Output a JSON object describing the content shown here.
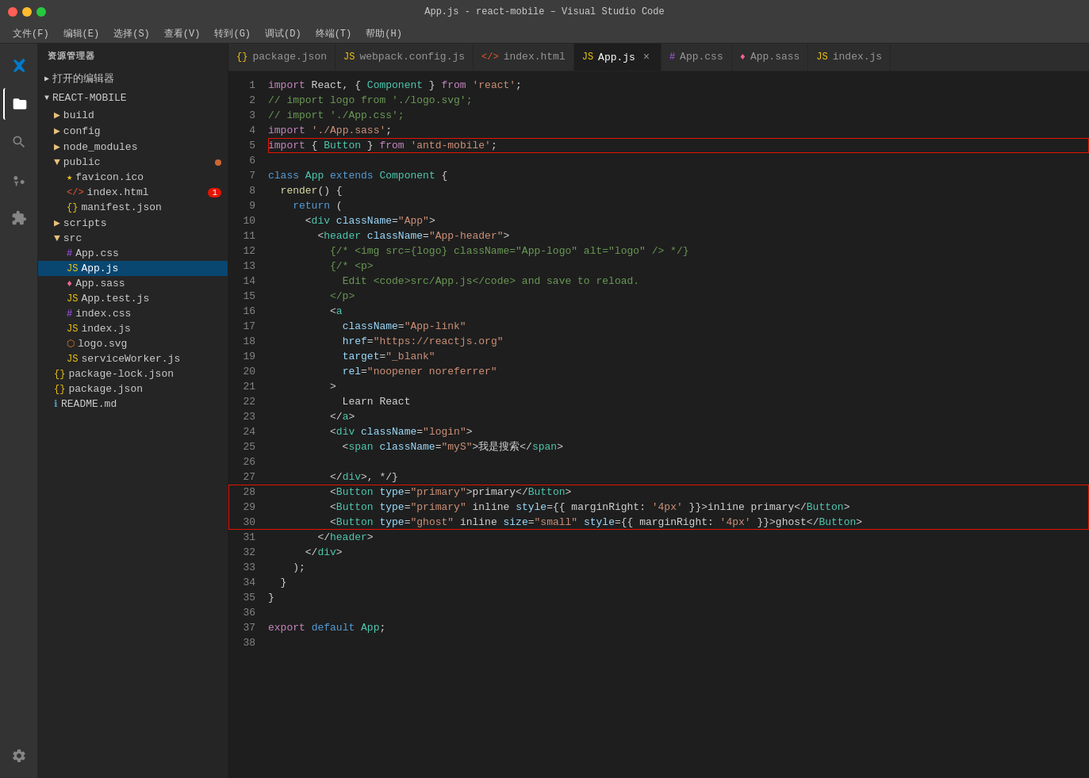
{
  "titleBar": {
    "title": "App.js - react-mobile – Visual Studio Code"
  },
  "menuBar": {
    "items": [
      "文件(F)",
      "编辑(E)",
      "选择(S)",
      "查看(V)",
      "转到(G)",
      "调试(D)",
      "终端(T)",
      "帮助(H)"
    ]
  },
  "sidebar": {
    "header": "资源管理器",
    "openEditors": "打开的编辑器",
    "rootFolder": "REACT-MOBILE",
    "tree": [
      {
        "name": "build",
        "type": "folder",
        "depth": 1
      },
      {
        "name": "config",
        "type": "folder",
        "depth": 1
      },
      {
        "name": "node_modules",
        "type": "folder",
        "depth": 1
      },
      {
        "name": "public",
        "type": "folder-open",
        "depth": 1,
        "hasDot": true
      },
      {
        "name": "favicon.ico",
        "type": "favicon",
        "depth": 2
      },
      {
        "name": "index.html",
        "type": "html",
        "depth": 2,
        "badge": "1"
      },
      {
        "name": "manifest.json",
        "type": "json",
        "depth": 2
      },
      {
        "name": "scripts",
        "type": "folder",
        "depth": 1
      },
      {
        "name": "src",
        "type": "folder-open",
        "depth": 1
      },
      {
        "name": "App.css",
        "type": "css",
        "depth": 2
      },
      {
        "name": "App.js",
        "type": "js",
        "depth": 2,
        "active": true
      },
      {
        "name": "App.sass",
        "type": "sass",
        "depth": 2
      },
      {
        "name": "App.test.js",
        "type": "js",
        "depth": 2
      },
      {
        "name": "index.css",
        "type": "css",
        "depth": 2
      },
      {
        "name": "index.js",
        "type": "js",
        "depth": 2
      },
      {
        "name": "logo.svg",
        "type": "svg",
        "depth": 2
      },
      {
        "name": "serviceWorker.js",
        "type": "js",
        "depth": 2
      },
      {
        "name": "package-lock.json",
        "type": "json",
        "depth": 0
      },
      {
        "name": "package.json",
        "type": "json",
        "depth": 0
      },
      {
        "name": "README.md",
        "type": "md",
        "depth": 0
      }
    ]
  },
  "tabs": [
    {
      "label": "package.json",
      "type": "json",
      "active": false
    },
    {
      "label": "webpack.config.js",
      "type": "js",
      "active": false
    },
    {
      "label": "index.html",
      "type": "html",
      "active": false
    },
    {
      "label": "App.js",
      "type": "js",
      "active": true,
      "closeable": true
    },
    {
      "label": "App.css",
      "type": "css",
      "active": false
    },
    {
      "label": "App.sass",
      "type": "sass",
      "active": false
    },
    {
      "label": "index.js",
      "type": "js",
      "active": false
    }
  ],
  "code": {
    "lines": [
      {
        "n": 1,
        "tokens": [
          {
            "t": "kw2",
            "v": "import"
          },
          {
            "t": "white",
            "v": " React, { "
          },
          {
            "t": "cl",
            "v": "Component"
          },
          {
            "t": "white",
            "v": " } "
          },
          {
            "t": "kw2",
            "v": "from"
          },
          {
            "t": "white",
            "v": " "
          },
          {
            "t": "str",
            "v": "'react'"
          },
          {
            "t": "white",
            "v": ";"
          }
        ]
      },
      {
        "n": 2,
        "tokens": [
          {
            "t": "cmt",
            "v": "// import logo from './logo.svg';"
          }
        ]
      },
      {
        "n": 3,
        "tokens": [
          {
            "t": "cmt",
            "v": "// import './App.css';"
          }
        ]
      },
      {
        "n": 4,
        "tokens": [
          {
            "t": "kw2",
            "v": "import"
          },
          {
            "t": "white",
            "v": " "
          },
          {
            "t": "str",
            "v": "'./App.sass'"
          },
          {
            "t": "white",
            "v": ";"
          }
        ]
      },
      {
        "n": 5,
        "tokens": [
          {
            "t": "kw2",
            "v": "import"
          },
          {
            "t": "white",
            "v": " { "
          },
          {
            "t": "cl",
            "v": "Button"
          },
          {
            "t": "white",
            "v": " } "
          },
          {
            "t": "kw2",
            "v": "from"
          },
          {
            "t": "white",
            "v": " "
          },
          {
            "t": "str",
            "v": "'antd-mobile'"
          },
          {
            "t": "white",
            "v": ";"
          }
        ],
        "highlight": true
      },
      {
        "n": 6,
        "tokens": []
      },
      {
        "n": 7,
        "tokens": [
          {
            "t": "kw",
            "v": "class"
          },
          {
            "t": "white",
            "v": " "
          },
          {
            "t": "cl",
            "v": "App"
          },
          {
            "t": "white",
            "v": " "
          },
          {
            "t": "kw",
            "v": "extends"
          },
          {
            "t": "white",
            "v": " "
          },
          {
            "t": "cl",
            "v": "Component"
          },
          {
            "t": "white",
            "v": " {"
          }
        ]
      },
      {
        "n": 8,
        "tokens": [
          {
            "t": "white",
            "v": "  "
          },
          {
            "t": "fn",
            "v": "render"
          },
          {
            "t": "white",
            "v": "() {"
          }
        ]
      },
      {
        "n": 9,
        "tokens": [
          {
            "t": "white",
            "v": "    "
          },
          {
            "t": "kw",
            "v": "return"
          },
          {
            "t": "white",
            "v": " ("
          }
        ]
      },
      {
        "n": 10,
        "tokens": [
          {
            "t": "white",
            "v": "      "
          },
          {
            "t": "white",
            "v": "<"
          },
          {
            "t": "teal",
            "v": "div"
          },
          {
            "t": "white",
            "v": " "
          },
          {
            "t": "lt-blue",
            "v": "className"
          },
          {
            "t": "white",
            "v": "="
          },
          {
            "t": "str",
            "v": "\"App\""
          },
          {
            "t": "white",
            "v": ">"
          }
        ]
      },
      {
        "n": 11,
        "tokens": [
          {
            "t": "white",
            "v": "        "
          },
          {
            "t": "white",
            "v": "<"
          },
          {
            "t": "teal",
            "v": "header"
          },
          {
            "t": "white",
            "v": " "
          },
          {
            "t": "lt-blue",
            "v": "className"
          },
          {
            "t": "white",
            "v": "="
          },
          {
            "t": "str",
            "v": "\"App-header\""
          },
          {
            "t": "white",
            "v": ">"
          }
        ]
      },
      {
        "n": 12,
        "tokens": [
          {
            "t": "white",
            "v": "          "
          },
          {
            "t": "cmt",
            "v": "{/* <img src={logo} className=\"App-logo\" alt=\"logo\" /> */}"
          }
        ]
      },
      {
        "n": 13,
        "tokens": [
          {
            "t": "white",
            "v": "          "
          },
          {
            "t": "cmt",
            "v": "{/* <p>"
          }
        ]
      },
      {
        "n": 14,
        "tokens": [
          {
            "t": "white",
            "v": "            "
          },
          {
            "t": "cmt",
            "v": "Edit <code>src/App.js</code> and save to reload."
          }
        ]
      },
      {
        "n": 15,
        "tokens": [
          {
            "t": "white",
            "v": "          "
          },
          {
            "t": "cmt",
            "v": "</p>"
          }
        ]
      },
      {
        "n": 16,
        "tokens": [
          {
            "t": "white",
            "v": "          "
          },
          {
            "t": "white",
            "v": "<"
          },
          {
            "t": "teal",
            "v": "a"
          }
        ]
      },
      {
        "n": 17,
        "tokens": [
          {
            "t": "white",
            "v": "            "
          },
          {
            "t": "lt-blue",
            "v": "className"
          },
          {
            "t": "white",
            "v": "="
          },
          {
            "t": "str",
            "v": "\"App-link\""
          }
        ]
      },
      {
        "n": 18,
        "tokens": [
          {
            "t": "white",
            "v": "            "
          },
          {
            "t": "lt-blue",
            "v": "href"
          },
          {
            "t": "white",
            "v": "="
          },
          {
            "t": "str",
            "v": "\"https://reactjs.org\""
          }
        ]
      },
      {
        "n": 19,
        "tokens": [
          {
            "t": "white",
            "v": "            "
          },
          {
            "t": "lt-blue",
            "v": "target"
          },
          {
            "t": "white",
            "v": "="
          },
          {
            "t": "str",
            "v": "\"_blank\""
          }
        ]
      },
      {
        "n": 20,
        "tokens": [
          {
            "t": "white",
            "v": "            "
          },
          {
            "t": "lt-blue",
            "v": "rel"
          },
          {
            "t": "white",
            "v": "="
          },
          {
            "t": "str",
            "v": "\"noopener noreferrer\""
          }
        ]
      },
      {
        "n": 21,
        "tokens": [
          {
            "t": "white",
            "v": "          "
          },
          {
            "t": "white",
            "v": ">"
          }
        ]
      },
      {
        "n": 22,
        "tokens": [
          {
            "t": "white",
            "v": "            "
          },
          {
            "t": "white",
            "v": "Learn React"
          }
        ]
      },
      {
        "n": 23,
        "tokens": [
          {
            "t": "white",
            "v": "          </"
          },
          {
            "t": "teal",
            "v": "a"
          },
          {
            "t": "white",
            "v": ">"
          }
        ]
      },
      {
        "n": 24,
        "tokens": [
          {
            "t": "white",
            "v": "          <"
          },
          {
            "t": "teal",
            "v": "div"
          },
          {
            "t": "white",
            "v": " "
          },
          {
            "t": "lt-blue",
            "v": "className"
          },
          {
            "t": "white",
            "v": "="
          },
          {
            "t": "str",
            "v": "\"login\""
          },
          {
            "t": "white",
            "v": ">"
          }
        ]
      },
      {
        "n": 25,
        "tokens": [
          {
            "t": "white",
            "v": "            <"
          },
          {
            "t": "teal",
            "v": "span"
          },
          {
            "t": "white",
            "v": " "
          },
          {
            "t": "lt-blue",
            "v": "className"
          },
          {
            "t": "white",
            "v": "="
          },
          {
            "t": "str",
            "v": "\"myS\""
          },
          {
            "t": "white",
            "v": ">我是搜索</"
          },
          {
            "t": "teal",
            "v": "span"
          },
          {
            "t": "white",
            "v": ">"
          }
        ]
      },
      {
        "n": 26,
        "tokens": []
      },
      {
        "n": 27,
        "tokens": [
          {
            "t": "white",
            "v": "          </"
          },
          {
            "t": "teal",
            "v": "div"
          },
          {
            "t": "white",
            "v": ">, */}"
          }
        ]
      },
      {
        "n": 28,
        "tokens": [
          {
            "t": "white",
            "v": "          <"
          },
          {
            "t": "teal",
            "v": "Button"
          },
          {
            "t": "white",
            "v": " "
          },
          {
            "t": "lt-blue",
            "v": "type"
          },
          {
            "t": "white",
            "v": "="
          },
          {
            "t": "str",
            "v": "\"primary\""
          },
          {
            "t": "white",
            "v": ">primary</"
          },
          {
            "t": "teal",
            "v": "Button"
          },
          {
            "t": "white",
            "v": ">"
          }
        ],
        "highlightGroup": true
      },
      {
        "n": 29,
        "tokens": [
          {
            "t": "white",
            "v": "          <"
          },
          {
            "t": "teal",
            "v": "Button"
          },
          {
            "t": "white",
            "v": " "
          },
          {
            "t": "lt-blue",
            "v": "type"
          },
          {
            "t": "white",
            "v": "="
          },
          {
            "t": "str",
            "v": "\"primary\""
          },
          {
            "t": "white",
            "v": " inline "
          },
          {
            "t": "lt-blue",
            "v": "style"
          },
          {
            "t": "white",
            "v": "={{"
          },
          {
            "t": "white",
            "v": " marginRight: "
          },
          {
            "t": "str",
            "v": "'4px'"
          },
          {
            "t": "white",
            "v": " }}>inline primary</"
          },
          {
            "t": "teal",
            "v": "Button"
          },
          {
            "t": "white",
            "v": ">"
          }
        ],
        "highlightGroup": true
      },
      {
        "n": 30,
        "tokens": [
          {
            "t": "white",
            "v": "          <"
          },
          {
            "t": "teal",
            "v": "Button"
          },
          {
            "t": "white",
            "v": " "
          },
          {
            "t": "lt-blue",
            "v": "type"
          },
          {
            "t": "white",
            "v": "="
          },
          {
            "t": "str",
            "v": "\"ghost\""
          },
          {
            "t": "white",
            "v": " inline "
          },
          {
            "t": "lt-blue",
            "v": "size"
          },
          {
            "t": "white",
            "v": "="
          },
          {
            "t": "str",
            "v": "\"small\""
          },
          {
            "t": "white",
            "v": " "
          },
          {
            "t": "lt-blue",
            "v": "style"
          },
          {
            "t": "white",
            "v": "={{"
          },
          {
            "t": "white",
            "v": " marginRight: "
          },
          {
            "t": "str",
            "v": "'4px'"
          },
          {
            "t": "white",
            "v": " }}>ghost</"
          },
          {
            "t": "teal",
            "v": "Button"
          },
          {
            "t": "white",
            "v": ">"
          }
        ],
        "highlightGroup": true
      },
      {
        "n": 31,
        "tokens": [
          {
            "t": "white",
            "v": "        </"
          },
          {
            "t": "teal",
            "v": "header"
          },
          {
            "t": "white",
            "v": ">"
          }
        ]
      },
      {
        "n": 32,
        "tokens": [
          {
            "t": "white",
            "v": "      </"
          },
          {
            "t": "teal",
            "v": "div"
          },
          {
            "t": "white",
            "v": ">"
          }
        ]
      },
      {
        "n": 33,
        "tokens": [
          {
            "t": "white",
            "v": "    );"
          }
        ]
      },
      {
        "n": 34,
        "tokens": [
          {
            "t": "white",
            "v": "  }"
          }
        ]
      },
      {
        "n": 35,
        "tokens": [
          {
            "t": "white",
            "v": "}"
          }
        ]
      },
      {
        "n": 36,
        "tokens": []
      },
      {
        "n": 37,
        "tokens": [
          {
            "t": "kw2",
            "v": "export"
          },
          {
            "t": "white",
            "v": " "
          },
          {
            "t": "kw",
            "v": "default"
          },
          {
            "t": "white",
            "v": " "
          },
          {
            "t": "cl",
            "v": "App"
          },
          {
            "t": "white",
            "v": ";"
          }
        ]
      },
      {
        "n": 38,
        "tokens": []
      }
    ]
  }
}
